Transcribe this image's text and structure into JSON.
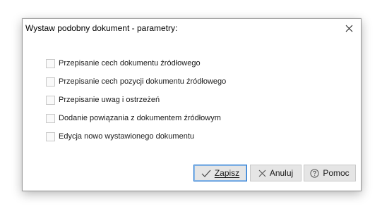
{
  "dialog": {
    "title": "Wystaw podobny dokument - parametry:",
    "close_icon": "close-icon"
  },
  "options": [
    {
      "label": "Przepisanie cech dokumentu źródłowego",
      "checked": false
    },
    {
      "label": "Przepisanie cech pozycji dokumentu źródłowego",
      "checked": false
    },
    {
      "label": "Przepisanie uwag i ostrzeżeń",
      "checked": false
    },
    {
      "label": "Dodanie powiązania z dokumentem źródłowym",
      "checked": false
    },
    {
      "label": "Edycja nowo wystawionego dokumentu",
      "checked": false
    }
  ],
  "buttons": {
    "save": {
      "label": "Zapisz",
      "icon": "checkmark-icon"
    },
    "cancel": {
      "label": "Anuluj",
      "icon": "close-icon"
    },
    "help": {
      "label": "Pomoc",
      "icon": "question-circle-icon"
    }
  },
  "colors": {
    "default_button_border": "#1f74cf",
    "button_background": "#e5e5e5"
  }
}
